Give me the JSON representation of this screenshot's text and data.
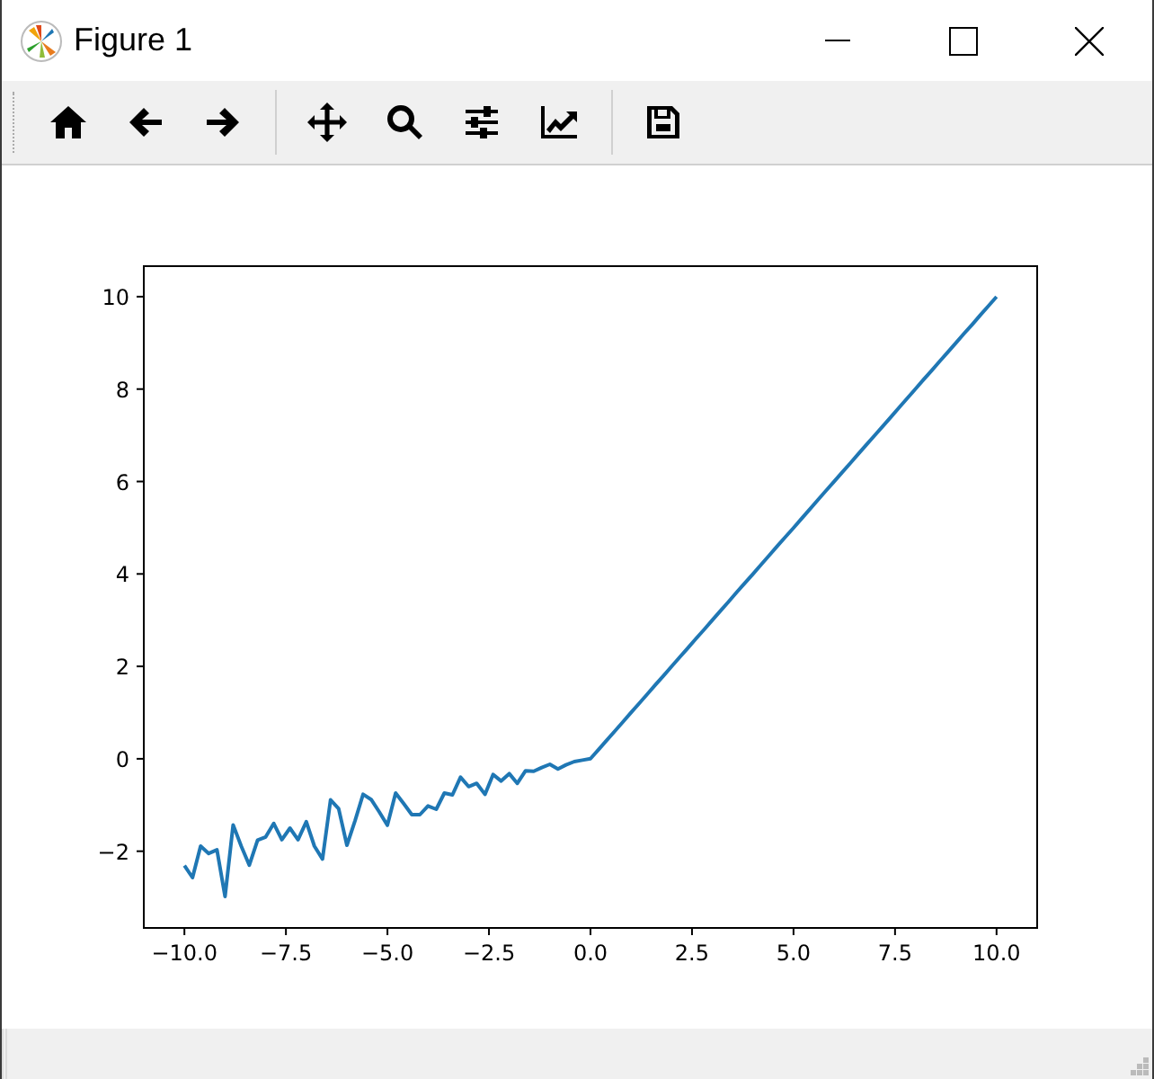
{
  "window": {
    "title": "Figure 1"
  },
  "figure": {
    "chart_data": {
      "type": "line",
      "x": [
        -10,
        -9.8,
        -9.6,
        -9.4,
        -9.2,
        -9,
        -8.8,
        -8.6,
        -8.4,
        -8.2,
        -8,
        -7.8,
        -7.6,
        -7.4,
        -7.2,
        -7,
        -6.8,
        -6.6,
        -6.4,
        -6.2,
        -6,
        -5.8,
        -5.6,
        -5.4,
        -5.2,
        -5,
        -4.8,
        -4.6,
        -4.4,
        -4.2,
        -4,
        -3.8,
        -3.6,
        -3.4,
        -3.2,
        -3,
        -2.8,
        -2.6,
        -2.4,
        -2.2,
        -2,
        -1.8,
        -1.6,
        -1.4,
        -1.2,
        -1,
        -0.8,
        -0.6,
        -0.4,
        -0.2,
        0,
        0.2,
        0.4,
        0.6,
        0.8,
        1,
        1.2,
        1.4,
        1.6,
        1.8,
        2,
        2.2,
        2.4,
        2.6,
        2.8,
        3,
        3.2,
        3.4,
        3.6,
        3.8,
        4,
        4.2,
        4.4,
        4.6,
        4.8,
        5,
        5.2,
        5.4,
        5.6,
        5.8,
        6,
        6.2,
        6.4,
        6.6,
        6.8,
        7,
        7.2,
        7.4,
        7.6,
        7.8,
        8,
        8.2,
        8.4,
        8.6,
        8.8,
        9,
        9.2,
        9.4,
        9.6,
        9.8,
        10
      ],
      "series": [
        {
          "color": "#1f77b4",
          "values": [
            -2.31,
            -2.57,
            -1.89,
            -2.05,
            -1.97,
            -2.98,
            -1.43,
            -1.89,
            -2.3,
            -1.76,
            -1.69,
            -1.4,
            -1.75,
            -1.5,
            -1.75,
            -1.36,
            -1.89,
            -2.17,
            -0.89,
            -1.08,
            -1.87,
            -1.34,
            -0.77,
            -0.88,
            -1.15,
            -1.44,
            -0.74,
            -0.97,
            -1.21,
            -1.21,
            -1.02,
            -1.09,
            -0.74,
            -0.78,
            -0.4,
            -0.6,
            -0.53,
            -0.77,
            -0.34,
            -0.48,
            -0.32,
            -0.53,
            -0.26,
            -0.27,
            -0.19,
            -0.12,
            -0.22,
            -0.13,
            -0.06,
            -0.03,
            0,
            0.2,
            0.4,
            0.6,
            0.8,
            1,
            1.2,
            1.4,
            1.6,
            1.8,
            2,
            2.2,
            2.4,
            2.6,
            2.8,
            3,
            3.2,
            3.4,
            3.6,
            3.8,
            4,
            4.2,
            4.4,
            4.6,
            4.8,
            5,
            5.2,
            5.4,
            5.6,
            5.8,
            6,
            6.2,
            6.4,
            6.6,
            6.8,
            7,
            7.2,
            7.4,
            7.6,
            7.8,
            8,
            8.2,
            8.4,
            8.6,
            8.8,
            9,
            9.2,
            9.4,
            9.6,
            9.8,
            10
          ]
        }
      ],
      "xlim": [
        -11,
        11
      ],
      "ylim": [
        -3.66,
        10.66
      ],
      "xticks": [
        {
          "value": -10,
          "label": "−10.0"
        },
        {
          "value": -7.5,
          "label": "−7.5"
        },
        {
          "value": -5,
          "label": "−5.0"
        },
        {
          "value": -2.5,
          "label": "−2.5"
        },
        {
          "value": 0,
          "label": "0.0"
        },
        {
          "value": 2.5,
          "label": "2.5"
        },
        {
          "value": 5,
          "label": "5.0"
        },
        {
          "value": 7.5,
          "label": "7.5"
        },
        {
          "value": 10,
          "label": "10.0"
        }
      ],
      "yticks": [
        {
          "value": -2,
          "label": "−2"
        },
        {
          "value": 0,
          "label": "0"
        },
        {
          "value": 2,
          "label": "2"
        },
        {
          "value": 4,
          "label": "4"
        },
        {
          "value": 6,
          "label": "6"
        },
        {
          "value": 8,
          "label": "8"
        },
        {
          "value": 10,
          "label": "10"
        }
      ]
    }
  }
}
